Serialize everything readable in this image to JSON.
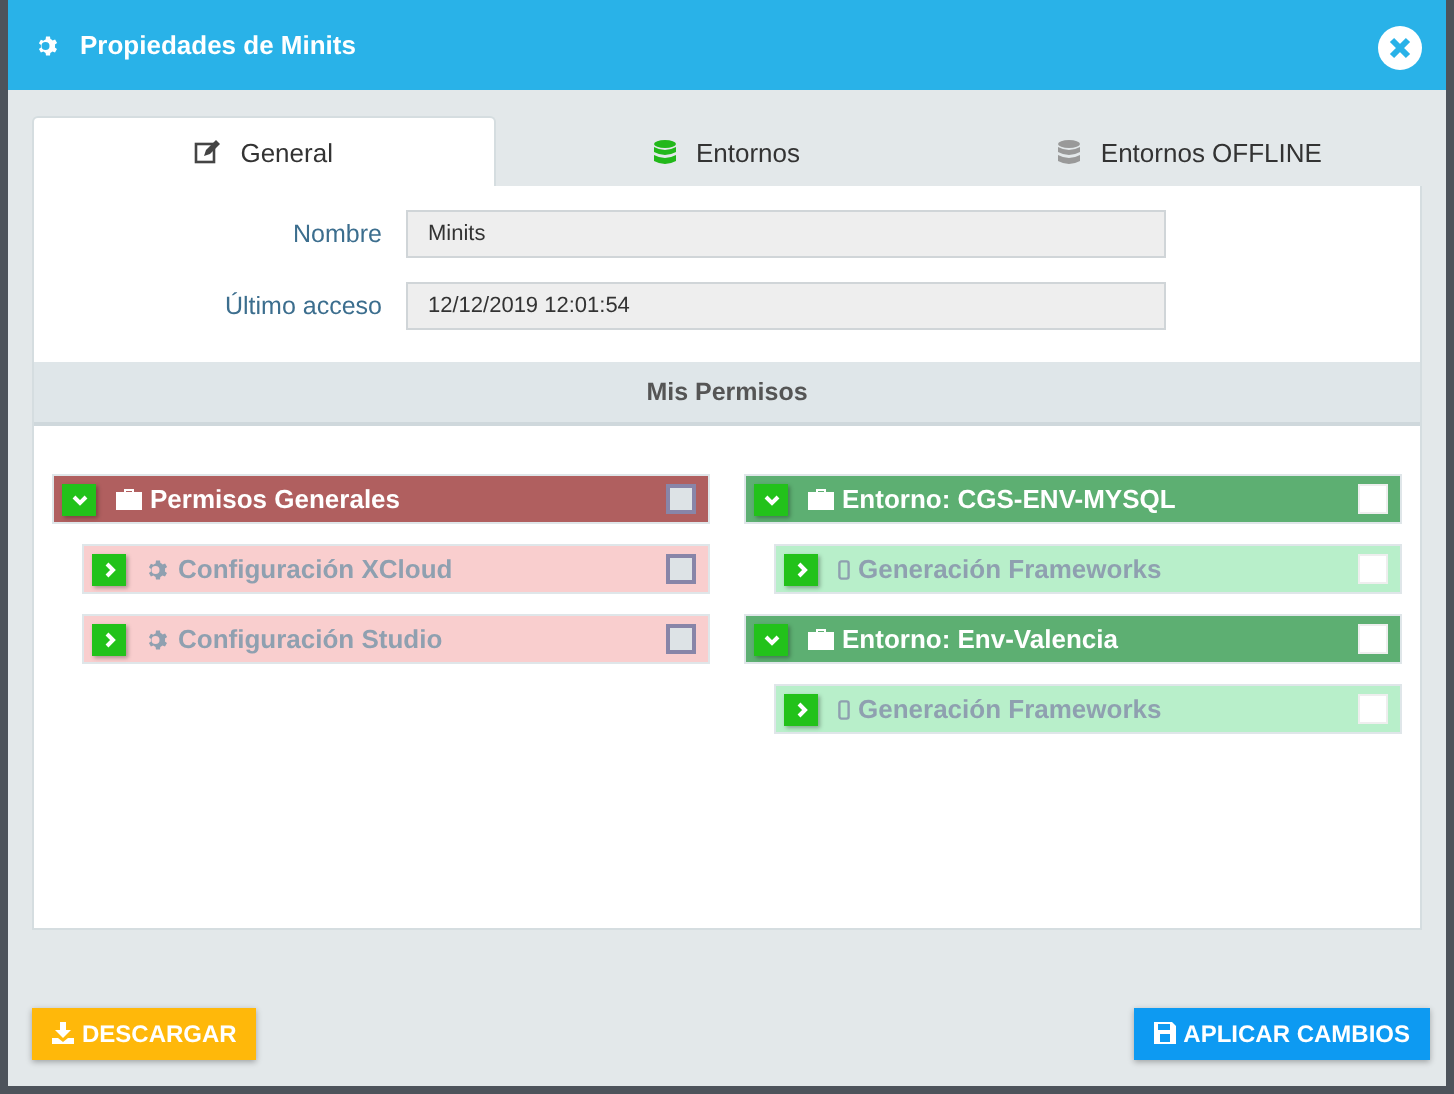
{
  "window": {
    "title": "Propiedades de Minits"
  },
  "tabs": [
    {
      "label": "General",
      "kind": "edit",
      "selected": true
    },
    {
      "label": "Entornos",
      "kind": "db-green",
      "selected": false
    },
    {
      "label": "Entornos OFFLINE",
      "kind": "db-grey",
      "selected": false
    }
  ],
  "fields": [
    {
      "label": "Nombre",
      "value": "Minits"
    },
    {
      "label": "Último acceso",
      "value": "12/12/2019 12:01:54"
    }
  ],
  "section_title": "Mis Permisos",
  "columns": [
    {
      "groups": [
        {
          "label": "Permisos Generales",
          "color": "#b05f5f",
          "expanded": true,
          "checked": false,
          "disabled": true,
          "children": [
            {
              "label": "Configuración XCloud",
              "kind": "gear",
              "expanded": false,
              "checked": false,
              "disabled": true
            },
            {
              "label": "Configuración Studio",
              "kind": "gear",
              "expanded": false,
              "checked": false,
              "disabled": true
            }
          ]
        }
      ]
    },
    {
      "groups": [
        {
          "label": "Entorno: CGS-ENV-MYSQL",
          "color": "#5daf72",
          "expanded": true,
          "checked": false,
          "disabled": false,
          "children": [
            {
              "label": "Generación Frameworks",
              "kind": "mobile",
              "expanded": false,
              "checked": false,
              "disabled": false
            }
          ]
        },
        {
          "label": "Entorno: Env-Valencia",
          "color": "#5daf72",
          "expanded": true,
          "checked": false,
          "disabled": false,
          "children": [
            {
              "label": "Generación Frameworks",
              "kind": "mobile",
              "expanded": false,
              "checked": false,
              "disabled": false
            }
          ]
        }
      ]
    }
  ],
  "buttons": [
    {
      "label": "DESCARGAR",
      "kind": "download"
    },
    {
      "label": "APLICAR CAMBIOS",
      "kind": "save"
    }
  ]
}
